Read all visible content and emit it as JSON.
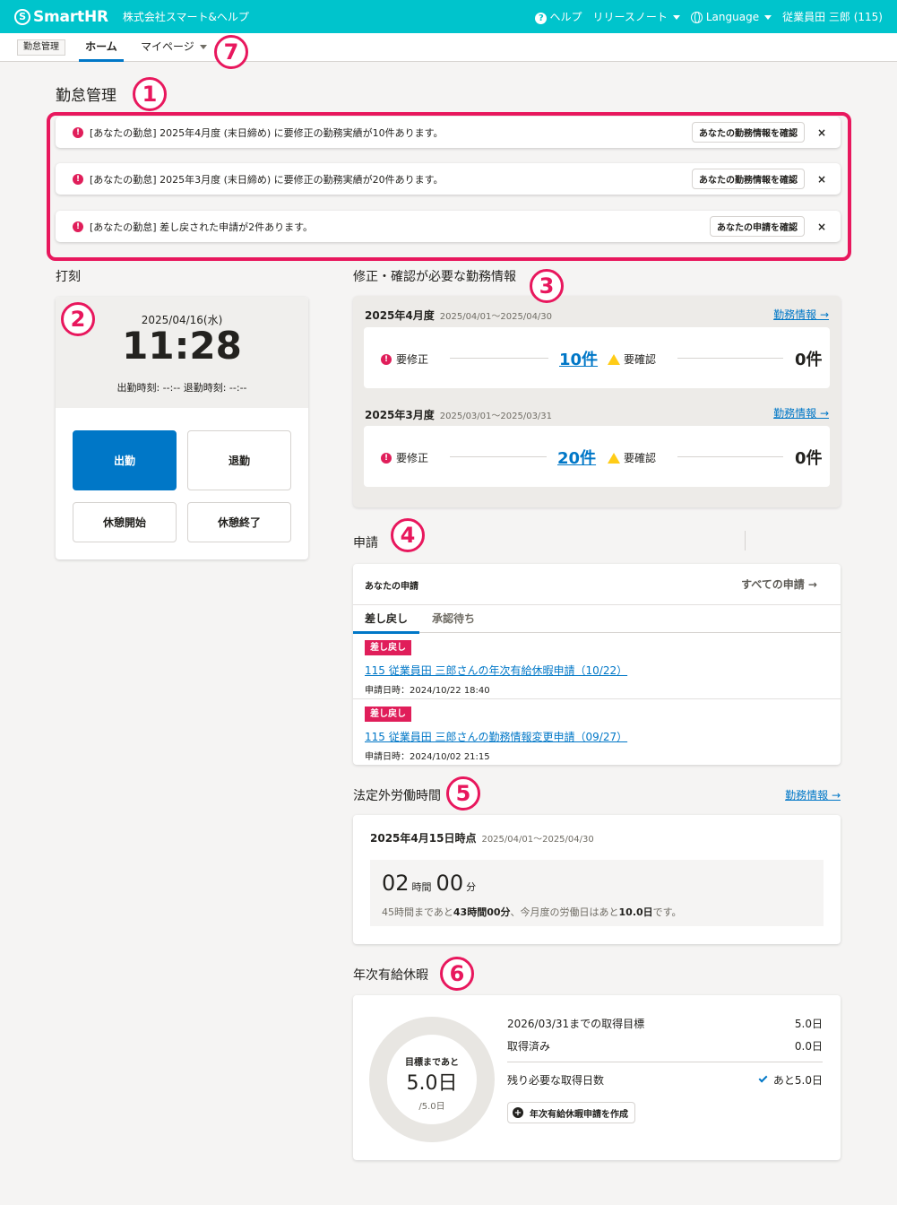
{
  "header": {
    "logo_mark": "S",
    "logo_text": "SmartHR",
    "company": "株式会社スマート&ヘルプ",
    "help_icon_glyph": "?",
    "help": "ヘルプ",
    "release_notes": "リリースノート",
    "language": "Language",
    "user": "従業員田 三郎 (115)",
    "brand_color": "#00c4cc"
  },
  "tabs": {
    "app_badge": "勤怠管理",
    "home": "ホーム",
    "mypage": "マイページ"
  },
  "annotations": [
    "1",
    "2",
    "3",
    "4",
    "5",
    "6",
    "7"
  ],
  "page_title": "勤怠管理",
  "alerts": [
    {
      "icon": "!",
      "text": "[あなたの勤怠] 2025年4月度 (末日締め) に要修正の勤務実績が10件あります。",
      "button": "あなたの勤務情報を確認",
      "close": "×"
    },
    {
      "icon": "!",
      "text": "[あなたの勤怠] 2025年3月度 (末日締め) に要修正の勤務実績が20件あります。",
      "button": "あなたの勤務情報を確認",
      "close": "×"
    },
    {
      "icon": "!",
      "text": "[あなたの勤怠] 差し戻された申請が2件あります。",
      "button": "あなたの申請を確認",
      "close": "×"
    }
  ],
  "punch": {
    "title": "打刻",
    "date": "2025/04/16(水)",
    "time": "11:28",
    "in_out": "出勤時刻: --:--  退勤時刻: --:--",
    "clock_in": "出勤",
    "clock_out": "退勤",
    "break_start": "休憩開始",
    "break_end": "休憩終了"
  },
  "work": {
    "title": "修正・確認が必要な勤務情報",
    "months": [
      {
        "month": "2025年4月度",
        "range": "2025/04/01〜2025/04/30",
        "link": "勤務情報 →",
        "fix_label": "要修正",
        "fix_count": "10件",
        "check_label": "要確認",
        "check_count": "0件"
      },
      {
        "month": "2025年3月度",
        "range": "2025/03/01〜2025/03/31",
        "link": "勤務情報 →",
        "fix_label": "要修正",
        "fix_count": "20件",
        "check_label": "要確認",
        "check_count": "0件"
      }
    ]
  },
  "requests": {
    "title": "申請",
    "heading": "あなたの申請",
    "all": "すべての申請 →",
    "tab_returned": "差し戻し",
    "tab_pending": "承認待ち",
    "items": [
      {
        "badge": "差し戻し",
        "title": "115 従業員田 三郎さんの年次有給休暇申請（10/22）",
        "date": "申請日時：2024/10/22 18:40"
      },
      {
        "badge": "差し戻し",
        "title": "115 従業員田 三郎さんの勤務情報変更申請（09/27）",
        "date": "申請日時：2024/10/02 21:15"
      }
    ]
  },
  "overtime": {
    "title": "法定外労働時間",
    "link": "勤務情報 →",
    "as_of": "2025年4月15日時点",
    "range": "2025/04/01〜2025/04/30",
    "hours": "02",
    "hours_unit": "時間",
    "minutes": "00",
    "minutes_unit": "分",
    "note_prefix": "45時間まであと",
    "note_remaining": "43時間00分",
    "note_middle": "、今月度の労働日はあと",
    "note_days": "10.0日",
    "note_suffix": "です。"
  },
  "leave": {
    "title": "年次有給休暇",
    "donut_label": "目標まであと",
    "donut_value": "5.0日",
    "donut_sub": "/5.0日",
    "target_label": "2026/03/31までの取得目標",
    "target_value": "5.0日",
    "taken_label": "取得済み",
    "taken_value": "0.0日",
    "remain_label": "残り必要な取得日数",
    "remain_value": "あと5.0日",
    "create_icon": "+",
    "create_button": "年次有給休暇申請を作成",
    "progress": 0
  }
}
